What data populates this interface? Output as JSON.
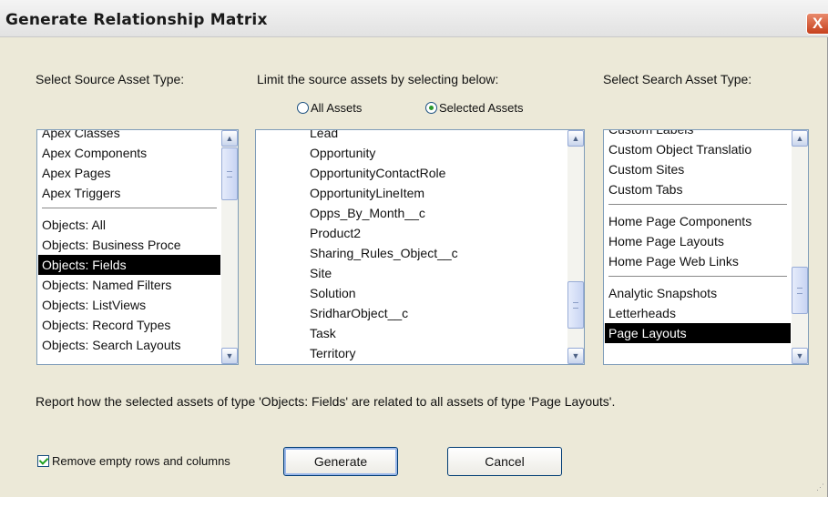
{
  "title": "Generate Relationship Matrix",
  "close_glyph": "X",
  "labels": {
    "source": "Select Source Asset Type:",
    "limit": "Limit the source assets by selecting below:",
    "search": "Select Search Asset Type:"
  },
  "radios": {
    "all": "All Assets",
    "selected": "Selected Assets"
  },
  "source_list": [
    "Apex Classes",
    "Apex Components",
    "Apex Pages",
    "Apex Triggers",
    "---",
    "Objects: All",
    "Objects: Business Proce",
    "Objects: Fields",
    "Objects: Named Filters",
    "Objects: ListViews",
    "Objects: Record Types",
    "Objects: Search Layouts"
  ],
  "assets_list": [
    "Lead",
    "Opportunity",
    "OpportunityContactRole",
    "OpportunityLineItem",
    "Opps_By_Month__c",
    "Product2",
    "Sharing_Rules_Object__c",
    "Site",
    "Solution",
    "SridharObject__c",
    "Task",
    "Territory"
  ],
  "search_list": [
    "Custom Labels",
    "Custom Object Translatio",
    "Custom Sites",
    "Custom Tabs",
    "---",
    "Home Page Components",
    "Home Page Layouts",
    "Home Page Web Links",
    "---",
    "Analytic Snapshots",
    "Letterheads",
    "Page Layouts"
  ],
  "report_text": "Report how the selected assets of type 'Objects: Fields' are related to all assets of type 'Page Layouts'.",
  "remove_empty_label": "Remove empty rows and columns",
  "buttons": {
    "generate": "Generate",
    "cancel": "Cancel"
  },
  "arrows": {
    "up": "▲",
    "down": "▼"
  },
  "colors": {
    "selection": "#000000",
    "title_close": "#c6401c",
    "check_green": "#21a121"
  }
}
